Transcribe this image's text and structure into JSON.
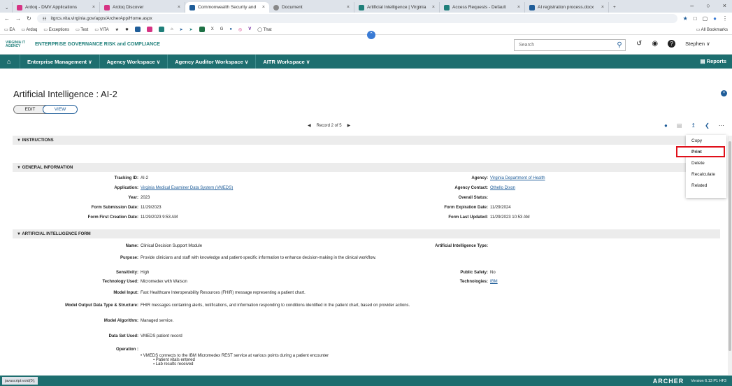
{
  "browser": {
    "tabs": [
      {
        "label": "Ardoq - DMV Applications",
        "color": "#d63384"
      },
      {
        "label": "Ardoq Discover",
        "color": "#d63384"
      },
      {
        "label": "Commonwealth Security and",
        "color": "#1f5d99",
        "active": true
      },
      {
        "label": "Document",
        "color": "#555"
      },
      {
        "label": "Artificial Intelligence | Virginia",
        "color": "#1f7f7a"
      },
      {
        "label": "Access Requests - Default",
        "color": "#1f7f7a"
      },
      {
        "label": "AI registration process.docx",
        "color": "#1f5d99"
      }
    ],
    "url": "itgrcs.vita.virginia.gov/apps/ArcherApp/Home.aspx",
    "bookmarks": [
      "EA",
      "Ardoq",
      "Exceptions",
      "Test",
      "VITA"
    ],
    "bookmark_last": "That",
    "all_bookmarks": "All Bookmarks"
  },
  "app": {
    "brand_small": "VIRGINIA IT AGENCY",
    "brand_title": "ENTERPRISE GOVERNANCE RISK and COMPLIANCE",
    "search_placeholder": "Search",
    "user": "Stephen ∨"
  },
  "nav": {
    "items": [
      "Enterprise Management ∨",
      "Agency Workspace ∨",
      "Agency Auditor Workspace ∨",
      "AITR Workspace ∨"
    ],
    "reports": "Reports"
  },
  "record": {
    "title": "Artificial Intelligence : AI-2",
    "edit": "EDIT",
    "view": "VIEW",
    "recnav": "Record 2 of 5"
  },
  "menu": [
    "Copy",
    "Print",
    "Delete",
    "Recalculate",
    "Related"
  ],
  "sections": {
    "instructions": "▼ INSTRUCTIONS",
    "general": "▼ GENERAL INFORMATION",
    "ai_form": "▼ ARTIFICIAL INTELLIGENCE FORM"
  },
  "general": {
    "tracking_l": "Tracking ID:",
    "tracking_v": "AI-2",
    "application_l": "Application:",
    "application_v": "Virginia Medical Examiner Data System (VMEDS)",
    "year_l": "Year:",
    "year_v": "2023",
    "fsd_l": "Form Submission Date:",
    "fsd_v": "11/29/2023",
    "ffcd_l": "Form First Creation Date:",
    "ffcd_v": "11/29/2023 9:53 AM",
    "agency_l": "Agency:",
    "agency_v": "Virginia Department of Health",
    "contact_l": "Agency Contact:",
    "contact_v": "Othello Dixon",
    "status_l": "Overall Status:",
    "fed_l": "Form Expiration Date:",
    "fed_v": "11/29/2024",
    "flu_l": "Form Last Updated:",
    "flu_v": "11/29/2023 10:53 AM"
  },
  "aiform": {
    "name_l": "Name:",
    "name_v": "Clinical Decision Support Module",
    "purpose_l": "Purpose:",
    "purpose_v": "Provide clinicians and staff with knowledge and patient-specific information to enhance decision-making in the clinical workflow.",
    "sens_l": "Sensitivity:",
    "sens_v": "High",
    "tech_l": "Technology Used:",
    "tech_v": "Micromedex with Watson",
    "input_l": "Model Input:",
    "input_v": "Fast Healthcare Interoperability Resources (FHIR) message representing a patient chart.",
    "output_l": "Model Output Data Type & Structure:",
    "output_v": "FHIR messages containing alerts, notifications, and information responding to conditions identified in the patient chart, based on provider actions.",
    "algo_l": "Model Algorithm:",
    "algo_v": "Managed service.",
    "dataset_l": "Data Set Used:",
    "dataset_v": "VMEDS patient record",
    "op_l": "Operation :",
    "op_v1": "VMEDS connects to the IBM Micromedex REST service at various points during a patient encounter",
    "op_v2": "Patient vitals entered",
    "op_v3": "Lab results received",
    "aitype_l": "Artificial Intelligence Type:",
    "safety_l": "Public Safety:",
    "safety_v": "No",
    "techs_l": "Technologies:",
    "techs_v": "IBM"
  },
  "footer": {
    "status": "javascript:void(0);",
    "brand": "ARCHER",
    "version": "Version 6.13 P1 HF3"
  }
}
